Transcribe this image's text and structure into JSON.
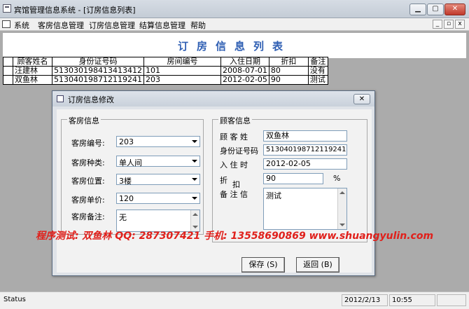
{
  "window": {
    "title": "宾馆管理信息系统 - [订房信息列表]",
    "min_label": "▁",
    "max_label": "▢",
    "close_label": "✕"
  },
  "menubar": {
    "items": [
      "系统",
      "客房信息管理",
      "订房信息管理",
      "结算信息管理",
      "帮助"
    ],
    "mdi_min": "_",
    "mdi_restore": "▫",
    "mdi_close": "x"
  },
  "list": {
    "title": "订房信息列表",
    "columns": [
      "顾客姓名",
      "身份证号码",
      "房间编号",
      "入住日期",
      "折扣",
      "备注"
    ],
    "rows": [
      [
        "汪建林",
        "513030198413413412",
        "101",
        "2008-07-01",
        "80",
        "没有"
      ],
      [
        "双鱼林",
        "513040198712119241",
        "203",
        "2012-02-05",
        "90",
        "测试"
      ]
    ]
  },
  "dialog": {
    "title": "订房信息修改",
    "close_label": "✕",
    "room_group": {
      "label": "客房信息",
      "room_no_label": "客房编号:",
      "room_no": "203",
      "room_type_label": "客房种类:",
      "room_type": "单人间",
      "room_location_label": "客房位置:",
      "room_location": "3楼",
      "room_price_label": "客房单价:",
      "room_price": "120",
      "room_note_label": "客房备注:",
      "room_note": "无"
    },
    "guest_group": {
      "label": "顾客信息",
      "name_label": "顾 客 姓",
      "name": "双鱼林",
      "id_label": "身份证号码",
      "id": "513040198712119241",
      "checkin_label": "入 住 时",
      "checkin": "2012-02-05",
      "discount_label": "折",
      "discount_label2": "扣",
      "discount": "90",
      "discount_unit": "%",
      "note_label": "备 注 信",
      "note": "测试"
    },
    "save_label": "保存 (S)",
    "back_label": "返回 (B)"
  },
  "watermark": "程序测试: 双鱼林   QQ: 287307421   手机: 13558690869   www.shuangyulin.com",
  "statusbar": {
    "status": "Status",
    "date": "2012/2/13",
    "time": "10:55"
  }
}
